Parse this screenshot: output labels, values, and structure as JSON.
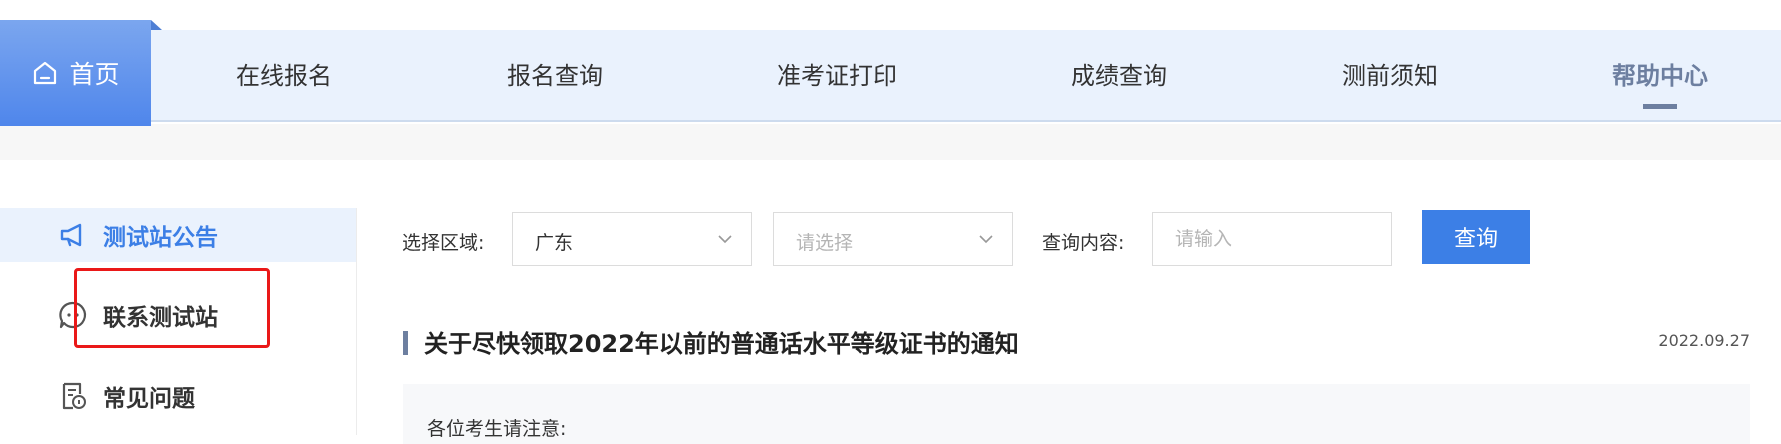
{
  "nav": {
    "home_label": "首页",
    "items": [
      "在线报名",
      "报名查询",
      "准考证打印",
      "成绩查询",
      "测前须知",
      "帮助中心"
    ],
    "active": "帮助中心"
  },
  "sidebar": {
    "items": [
      {
        "label": "测试站公告",
        "icon": "megaphone-icon"
      },
      {
        "label": "联系测试站",
        "icon": "chat-icon"
      },
      {
        "label": "常见问题",
        "icon": "faq-document-icon"
      }
    ]
  },
  "filter": {
    "region_label": "选择区域:",
    "province_value": "广东",
    "city_placeholder": "请选择",
    "query_label": "查询内容:",
    "query_placeholder": "请输入",
    "query_button": "查询"
  },
  "article": {
    "title": "关于尽快领取2022年以前的普通话水平等级证书的通知",
    "date": "2022.09.27",
    "greeting": "各位考生请注意:"
  },
  "colors": {
    "accent": "#3c7fe6",
    "nav_bg": "#eaf2fd",
    "highlight": "#ea1818"
  }
}
